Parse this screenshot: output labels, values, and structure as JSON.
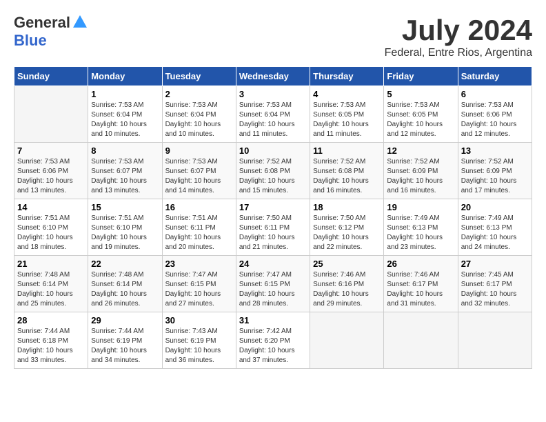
{
  "logo": {
    "general": "General",
    "blue": "Blue"
  },
  "title": "July 2024",
  "location": "Federal, Entre Rios, Argentina",
  "days_header": [
    "Sunday",
    "Monday",
    "Tuesday",
    "Wednesday",
    "Thursday",
    "Friday",
    "Saturday"
  ],
  "weeks": [
    [
      {
        "num": "",
        "info": ""
      },
      {
        "num": "1",
        "info": "Sunrise: 7:53 AM\nSunset: 6:04 PM\nDaylight: 10 hours\nand 10 minutes."
      },
      {
        "num": "2",
        "info": "Sunrise: 7:53 AM\nSunset: 6:04 PM\nDaylight: 10 hours\nand 10 minutes."
      },
      {
        "num": "3",
        "info": "Sunrise: 7:53 AM\nSunset: 6:04 PM\nDaylight: 10 hours\nand 11 minutes."
      },
      {
        "num": "4",
        "info": "Sunrise: 7:53 AM\nSunset: 6:05 PM\nDaylight: 10 hours\nand 11 minutes."
      },
      {
        "num": "5",
        "info": "Sunrise: 7:53 AM\nSunset: 6:05 PM\nDaylight: 10 hours\nand 12 minutes."
      },
      {
        "num": "6",
        "info": "Sunrise: 7:53 AM\nSunset: 6:06 PM\nDaylight: 10 hours\nand 12 minutes."
      }
    ],
    [
      {
        "num": "7",
        "info": "Sunrise: 7:53 AM\nSunset: 6:06 PM\nDaylight: 10 hours\nand 13 minutes."
      },
      {
        "num": "8",
        "info": "Sunrise: 7:53 AM\nSunset: 6:07 PM\nDaylight: 10 hours\nand 13 minutes."
      },
      {
        "num": "9",
        "info": "Sunrise: 7:53 AM\nSunset: 6:07 PM\nDaylight: 10 hours\nand 14 minutes."
      },
      {
        "num": "10",
        "info": "Sunrise: 7:52 AM\nSunset: 6:08 PM\nDaylight: 10 hours\nand 15 minutes."
      },
      {
        "num": "11",
        "info": "Sunrise: 7:52 AM\nSunset: 6:08 PM\nDaylight: 10 hours\nand 16 minutes."
      },
      {
        "num": "12",
        "info": "Sunrise: 7:52 AM\nSunset: 6:09 PM\nDaylight: 10 hours\nand 16 minutes."
      },
      {
        "num": "13",
        "info": "Sunrise: 7:52 AM\nSunset: 6:09 PM\nDaylight: 10 hours\nand 17 minutes."
      }
    ],
    [
      {
        "num": "14",
        "info": "Sunrise: 7:51 AM\nSunset: 6:10 PM\nDaylight: 10 hours\nand 18 minutes."
      },
      {
        "num": "15",
        "info": "Sunrise: 7:51 AM\nSunset: 6:10 PM\nDaylight: 10 hours\nand 19 minutes."
      },
      {
        "num": "16",
        "info": "Sunrise: 7:51 AM\nSunset: 6:11 PM\nDaylight: 10 hours\nand 20 minutes."
      },
      {
        "num": "17",
        "info": "Sunrise: 7:50 AM\nSunset: 6:11 PM\nDaylight: 10 hours\nand 21 minutes."
      },
      {
        "num": "18",
        "info": "Sunrise: 7:50 AM\nSunset: 6:12 PM\nDaylight: 10 hours\nand 22 minutes."
      },
      {
        "num": "19",
        "info": "Sunrise: 7:49 AM\nSunset: 6:13 PM\nDaylight: 10 hours\nand 23 minutes."
      },
      {
        "num": "20",
        "info": "Sunrise: 7:49 AM\nSunset: 6:13 PM\nDaylight: 10 hours\nand 24 minutes."
      }
    ],
    [
      {
        "num": "21",
        "info": "Sunrise: 7:48 AM\nSunset: 6:14 PM\nDaylight: 10 hours\nand 25 minutes."
      },
      {
        "num": "22",
        "info": "Sunrise: 7:48 AM\nSunset: 6:14 PM\nDaylight: 10 hours\nand 26 minutes."
      },
      {
        "num": "23",
        "info": "Sunrise: 7:47 AM\nSunset: 6:15 PM\nDaylight: 10 hours\nand 27 minutes."
      },
      {
        "num": "24",
        "info": "Sunrise: 7:47 AM\nSunset: 6:15 PM\nDaylight: 10 hours\nand 28 minutes."
      },
      {
        "num": "25",
        "info": "Sunrise: 7:46 AM\nSunset: 6:16 PM\nDaylight: 10 hours\nand 29 minutes."
      },
      {
        "num": "26",
        "info": "Sunrise: 7:46 AM\nSunset: 6:17 PM\nDaylight: 10 hours\nand 31 minutes."
      },
      {
        "num": "27",
        "info": "Sunrise: 7:45 AM\nSunset: 6:17 PM\nDaylight: 10 hours\nand 32 minutes."
      }
    ],
    [
      {
        "num": "28",
        "info": "Sunrise: 7:44 AM\nSunset: 6:18 PM\nDaylight: 10 hours\nand 33 minutes."
      },
      {
        "num": "29",
        "info": "Sunrise: 7:44 AM\nSunset: 6:19 PM\nDaylight: 10 hours\nand 34 minutes."
      },
      {
        "num": "30",
        "info": "Sunrise: 7:43 AM\nSunset: 6:19 PM\nDaylight: 10 hours\nand 36 minutes."
      },
      {
        "num": "31",
        "info": "Sunrise: 7:42 AM\nSunset: 6:20 PM\nDaylight: 10 hours\nand 37 minutes."
      },
      {
        "num": "",
        "info": ""
      },
      {
        "num": "",
        "info": ""
      },
      {
        "num": "",
        "info": ""
      }
    ]
  ]
}
